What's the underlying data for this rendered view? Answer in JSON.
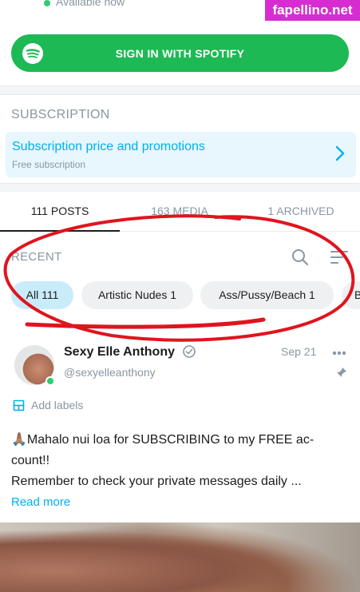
{
  "status": {
    "text": "Available now"
  },
  "watermark": "fapellino.net",
  "spotify": {
    "label": "SIGN IN WITH SPOTIFY"
  },
  "subscription": {
    "heading": "SUBSCRIPTION",
    "title": "Subscription price and promotions",
    "subtitle": "Free subscription"
  },
  "tabs": [
    {
      "label": "111 POSTS"
    },
    {
      "label": "163 MEDIA"
    },
    {
      "label": "1 ARCHIVED"
    }
  ],
  "recent": {
    "label": "RECENT"
  },
  "chips": [
    {
      "label": "All 111"
    },
    {
      "label": "Artistic Nudes 1"
    },
    {
      "label": "Ass/Pussy/Beach 1"
    },
    {
      "label": "B"
    }
  ],
  "post": {
    "name": "Sexy Elle Anthony",
    "handle": "@sexyelleanthony",
    "date": "Sep 21",
    "add_labels": "Add labels",
    "line1": "🙏🏽Mahalo nui loa for SUBSCRIBING to my FREE ac-",
    "line2": "count!!",
    "line3": "Remember to check your private messages daily ...",
    "read_more": "Read more"
  },
  "colors": {
    "accent": "#00aff0",
    "spotify": "#1db954",
    "annotation": "#e0141e"
  }
}
